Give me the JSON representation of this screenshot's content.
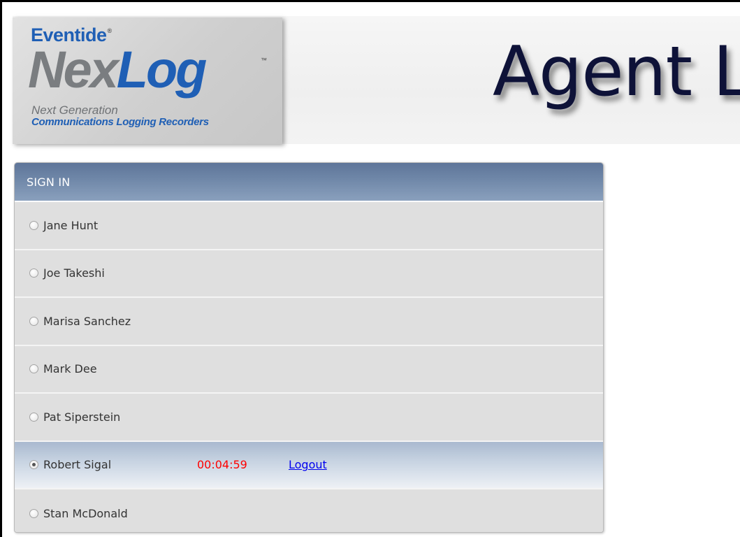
{
  "header": {
    "logo": {
      "brand": "Eventide",
      "brand_mark": "®",
      "product_nex": "Nex",
      "product_log": "Log",
      "trademark": "™",
      "tagline_line1": "Next Generation",
      "tagline_line2": "Communications Logging Recorders"
    },
    "title": "Agent L"
  },
  "panel": {
    "title": "SIGN IN",
    "agents": [
      {
        "name": "Jane Hunt",
        "selected": false
      },
      {
        "name": "Joe Takeshi",
        "selected": false
      },
      {
        "name": "Marisa Sanchez",
        "selected": false
      },
      {
        "name": "Mark Dee",
        "selected": false
      },
      {
        "name": "Pat Siperstein",
        "selected": false
      },
      {
        "name": "Robert Sigal",
        "selected": true,
        "timer": "00:04:59",
        "logout_label": "Logout"
      },
      {
        "name": "Stan McDonald",
        "selected": false
      }
    ]
  },
  "colors": {
    "header_gradient_top": "#5e7599",
    "active_row_top": "#a9b9cf",
    "timer": "#ff0000",
    "link": "#0000ee",
    "brand_blue": "#1f5fb5",
    "title_navy": "#0e1238"
  }
}
